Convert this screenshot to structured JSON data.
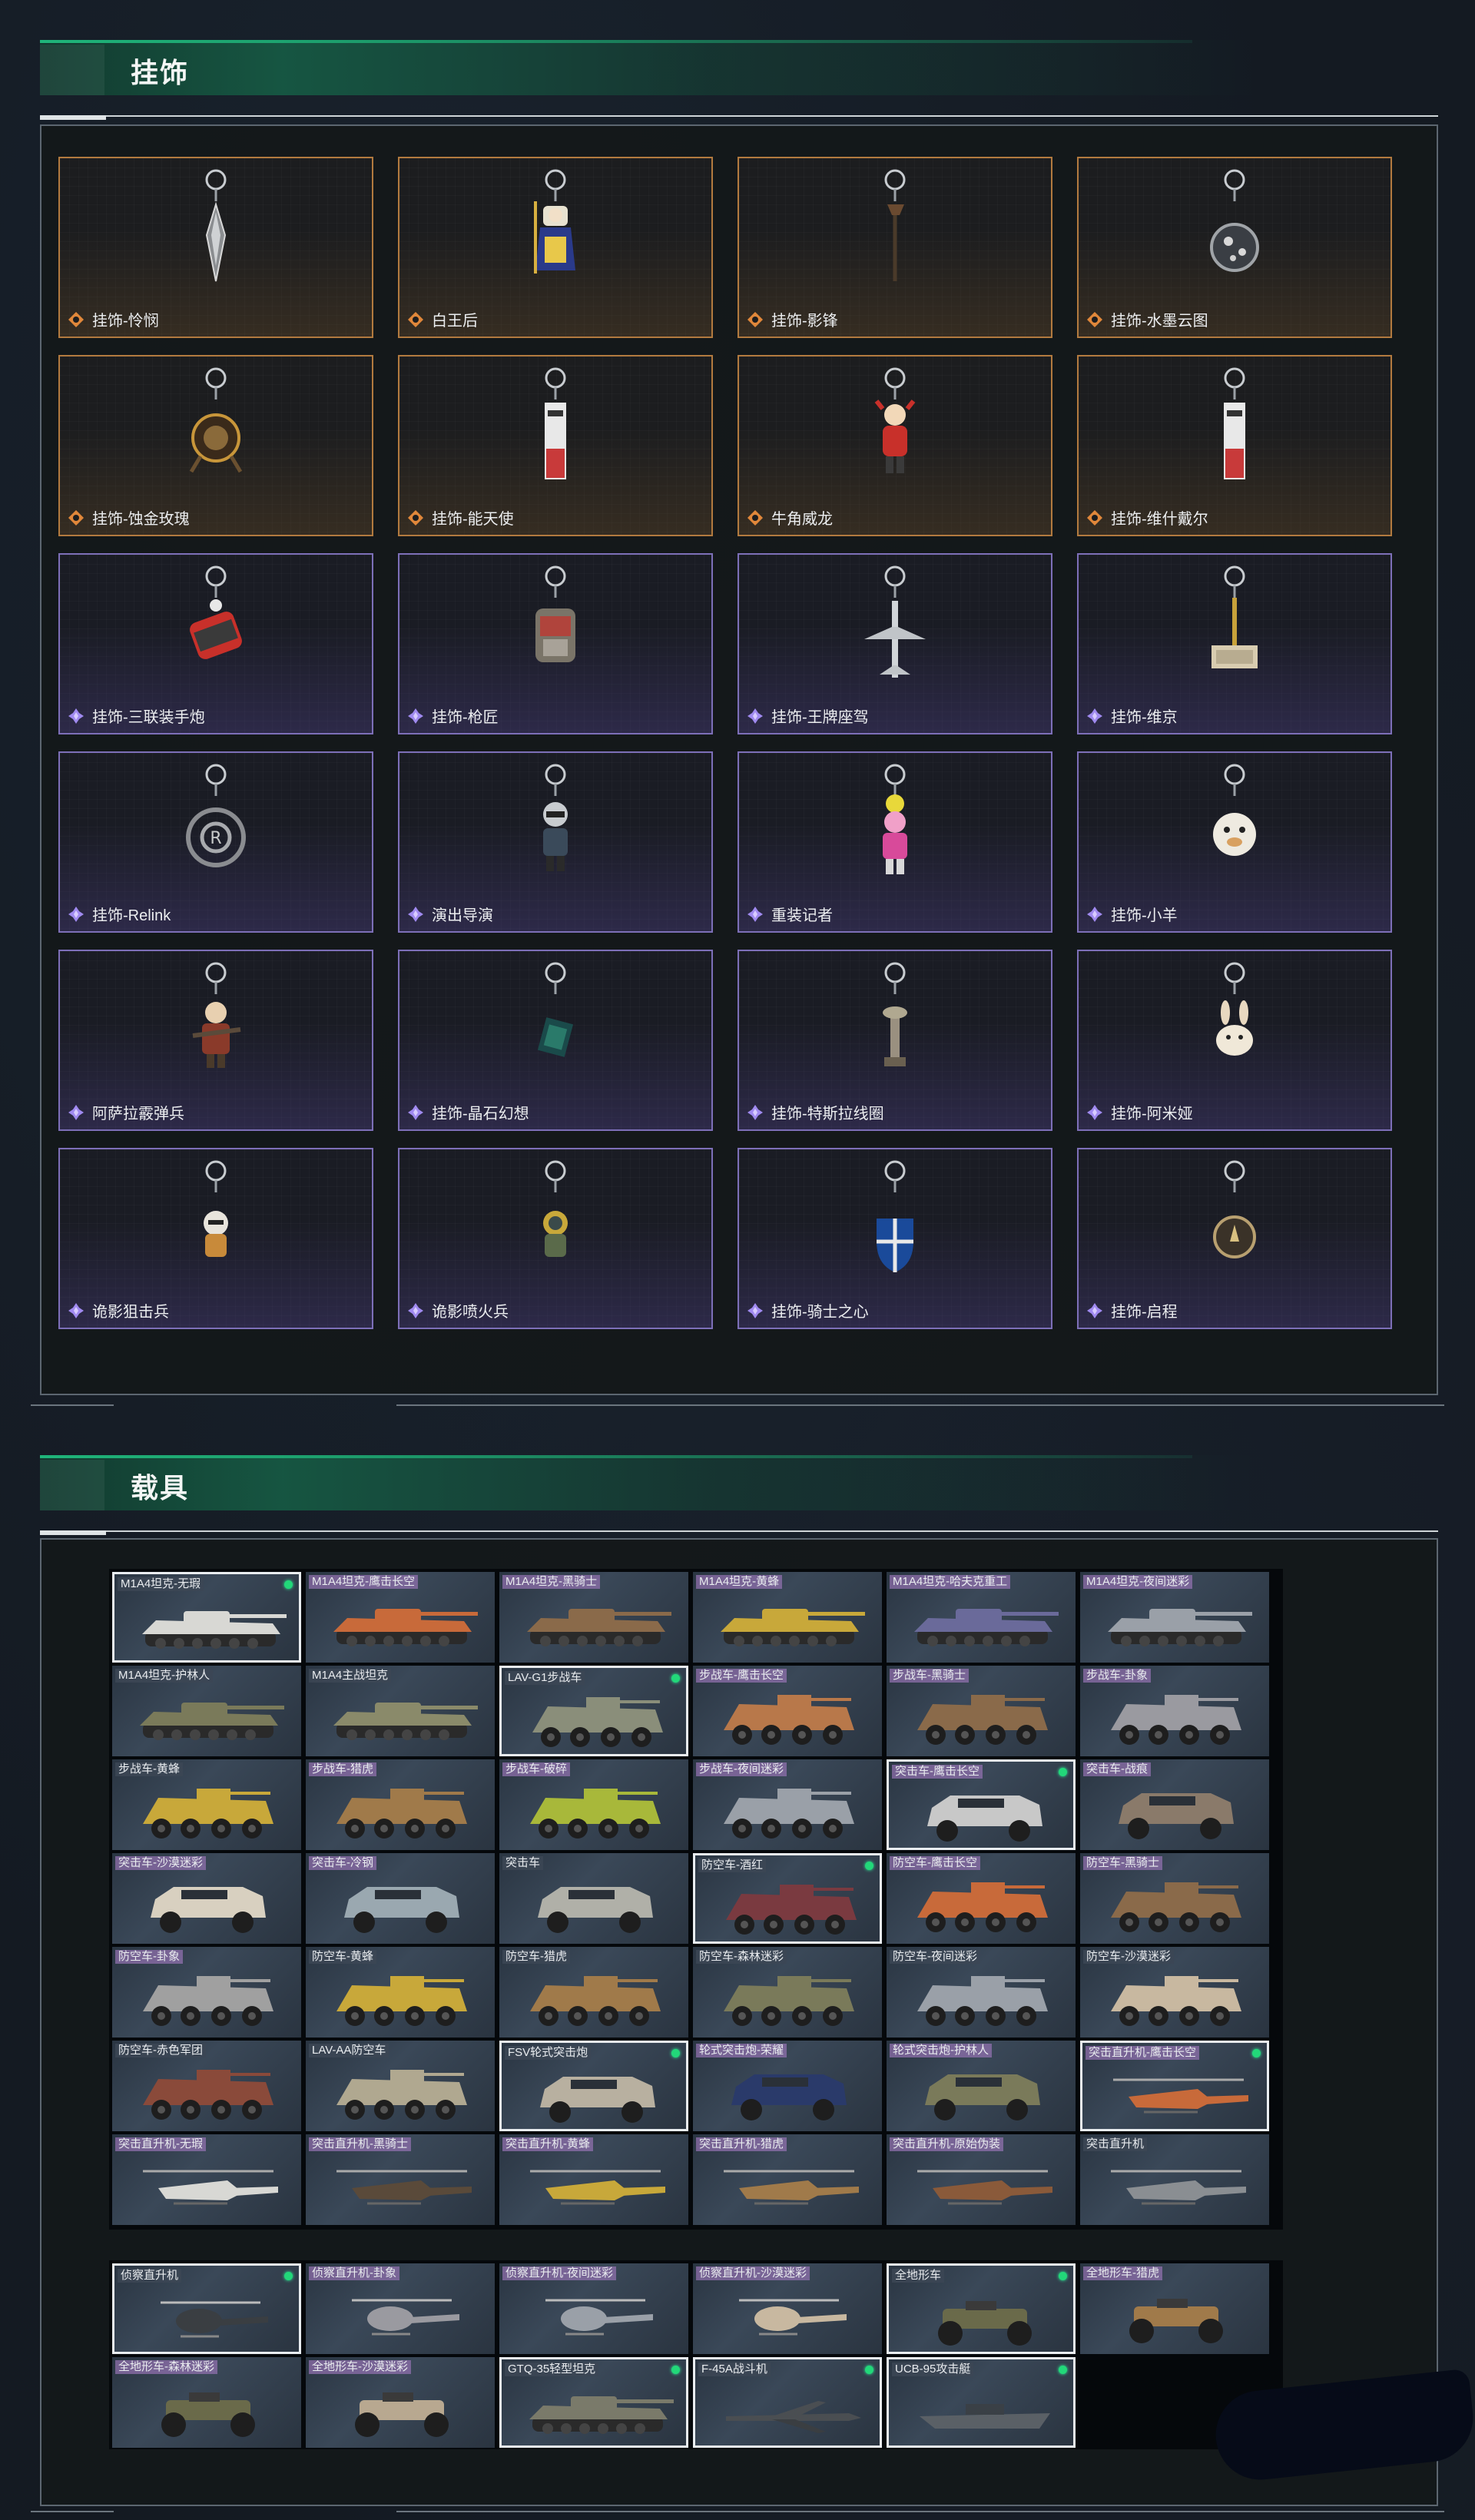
{
  "sections": {
    "charms_title": "挂饰",
    "vehicles_title": "载具"
  },
  "charms": [
    {
      "label": "挂饰-怜悯",
      "rarity": "gold",
      "icon": "charm-spike-icon"
    },
    {
      "label": "白王后",
      "rarity": "gold",
      "icon": "charm-queen-icon"
    },
    {
      "label": "挂饰-影锋",
      "rarity": "gold",
      "icon": "charm-blade-icon"
    },
    {
      "label": "挂饰-水墨云图",
      "rarity": "gold",
      "icon": "charm-orb-icon"
    },
    {
      "label": "挂饰-蚀金玫瑰",
      "rarity": "gold",
      "icon": "charm-rose-icon"
    },
    {
      "label": "挂饰-能天使",
      "rarity": "gold",
      "icon": "charm-tag-icon"
    },
    {
      "label": "牛角威龙",
      "rarity": "gold",
      "icon": "charm-figure-icon"
    },
    {
      "label": "挂饰-维什戴尔",
      "rarity": "gold",
      "icon": "charm-tag-icon"
    },
    {
      "label": "挂饰-三联装手炮",
      "rarity": "purple",
      "icon": "charm-cannon-icon"
    },
    {
      "label": "挂饰-枪匠",
      "rarity": "purple",
      "icon": "charm-pouch-icon"
    },
    {
      "label": "挂饰-王牌座驾",
      "rarity": "purple",
      "icon": "charm-jet-icon"
    },
    {
      "label": "挂饰-维京",
      "rarity": "purple",
      "icon": "charm-hammer-icon"
    },
    {
      "label": "挂饰-Relink",
      "rarity": "purple",
      "icon": "charm-knot-icon"
    },
    {
      "label": "演出导演",
      "rarity": "purple",
      "icon": "charm-soldier-icon"
    },
    {
      "label": "重装记者",
      "rarity": "purple",
      "icon": "charm-reporter-icon"
    },
    {
      "label": "挂饰-小羊",
      "rarity": "purple",
      "icon": "charm-lamb-icon"
    },
    {
      "label": "阿萨拉霰弹兵",
      "rarity": "purple",
      "icon": "charm-gunner-icon"
    },
    {
      "label": "挂饰-晶石幻想",
      "rarity": "purple",
      "icon": "charm-crystal-icon"
    },
    {
      "label": "挂饰-特斯拉线圈",
      "rarity": "purple",
      "icon": "charm-coil-icon"
    },
    {
      "label": "挂饰-阿米娅",
      "rarity": "purple",
      "icon": "charm-bunny-icon"
    },
    {
      "label": "诡影狙击兵",
      "rarity": "purple",
      "icon": "charm-sniper-icon"
    },
    {
      "label": "诡影喷火兵",
      "rarity": "purple",
      "icon": "charm-flamer-icon"
    },
    {
      "label": "挂饰-骑士之心",
      "rarity": "purple",
      "icon": "charm-shield-icon"
    },
    {
      "label": "挂饰-启程",
      "rarity": "purple",
      "icon": "charm-medal-icon"
    }
  ],
  "vehicles_main": [
    {
      "label": "M1A4坦克-无瑕",
      "selected": true,
      "dot": true,
      "kind": "tank",
      "color": "#d8d8d4"
    },
    {
      "label": "M1A4坦克-鹰击长空",
      "selected": false,
      "dot": false,
      "kind": "tank",
      "color": "#c86a3a",
      "hl": true
    },
    {
      "label": "M1A4坦克-黑骑士",
      "selected": false,
      "dot": false,
      "kind": "tank",
      "color": "#8a6a4a",
      "hl": true
    },
    {
      "label": "M1A4坦克-黄蜂",
      "selected": false,
      "dot": false,
      "kind": "tank",
      "color": "#c8a83a",
      "hl": true
    },
    {
      "label": "M1A4坦克-哈夫克重工",
      "selected": false,
      "dot": false,
      "kind": "tank",
      "color": "#6a6a9a",
      "hl": true
    },
    {
      "label": "M1A4坦克-夜间迷彩",
      "selected": false,
      "dot": false,
      "kind": "tank",
      "color": "#9aa0a8",
      "hl": true
    },
    {
      "label": "M1A4坦克-护林人",
      "selected": false,
      "dot": false,
      "kind": "tank",
      "color": "#7a7a5a",
      "hl": false
    },
    {
      "label": "M1A4主战坦克",
      "selected": false,
      "dot": false,
      "kind": "tank",
      "color": "#8a8a6a",
      "hl": false
    },
    {
      "label": "LAV-G1步战车",
      "selected": true,
      "dot": true,
      "kind": "ifv",
      "color": "#8a8e7a",
      "hl": false
    },
    {
      "label": "步战车-鹰击长空",
      "selected": false,
      "dot": false,
      "kind": "ifv",
      "color": "#b8784a",
      "hl": true
    },
    {
      "label": "步战车-黑骑士",
      "selected": false,
      "dot": false,
      "kind": "ifv",
      "color": "#8a6a4a",
      "hl": true
    },
    {
      "label": "步战车-卦象",
      "selected": false,
      "dot": false,
      "kind": "ifv",
      "color": "#9a9aa0",
      "hl": true
    },
    {
      "label": "步战车-黄蜂",
      "selected": false,
      "dot": false,
      "kind": "ifv",
      "color": "#c8a83a",
      "hl": false
    },
    {
      "label": "步战车-猎虎",
      "selected": false,
      "dot": false,
      "kind": "ifv",
      "color": "#a07a4a",
      "hl": true
    },
    {
      "label": "步战车-破碎",
      "selected": false,
      "dot": false,
      "kind": "ifv",
      "color": "#a8b83a",
      "hl": true
    },
    {
      "label": "步战车-夜间迷彩",
      "selected": false,
      "dot": false,
      "kind": "ifv",
      "color": "#9aa0a8",
      "hl": true
    },
    {
      "label": "突击车-鹰击长空",
      "selected": true,
      "dot": true,
      "kind": "car",
      "color": "#c8c8c8",
      "hl": true
    },
    {
      "label": "突击车-战痕",
      "selected": false,
      "dot": false,
      "kind": "car",
      "color": "#8a7a6a",
      "hl": true
    },
    {
      "label": "突击车-沙漠迷彩",
      "selected": false,
      "dot": false,
      "kind": "car",
      "color": "#d8d0c0",
      "hl": true
    },
    {
      "label": "突击车-冷钢",
      "selected": false,
      "dot": false,
      "kind": "car",
      "color": "#9aa8b0",
      "hl": true
    },
    {
      "label": "突击车",
      "selected": false,
      "dot": false,
      "kind": "car",
      "color": "#b0b0a8",
      "hl": false
    },
    {
      "label": "防空车-酒红",
      "selected": true,
      "dot": true,
      "kind": "aa",
      "color": "#7a3a40",
      "hl": false
    },
    {
      "label": "防空车-鹰击长空",
      "selected": false,
      "dot": false,
      "kind": "aa",
      "color": "#c86a3a",
      "hl": true
    },
    {
      "label": "防空车-黑骑士",
      "selected": false,
      "dot": false,
      "kind": "aa",
      "color": "#8a6a4a",
      "hl": true
    },
    {
      "label": "防空车-卦象",
      "selected": false,
      "dot": false,
      "kind": "aa",
      "color": "#a0a0a0",
      "hl": true
    },
    {
      "label": "防空车-黄蜂",
      "selected": false,
      "dot": false,
      "kind": "aa",
      "color": "#c8a83a",
      "hl": false
    },
    {
      "label": "防空车-猎虎",
      "selected": false,
      "dot": false,
      "kind": "aa",
      "color": "#a07a4a",
      "hl": false
    },
    {
      "label": "防空车-森林迷彩",
      "selected": false,
      "dot": false,
      "kind": "aa",
      "color": "#7a7a5a",
      "hl": false
    },
    {
      "label": "防空车-夜间迷彩",
      "selected": false,
      "dot": false,
      "kind": "aa",
      "color": "#9aa0a8",
      "hl": false
    },
    {
      "label": "防空车-沙漠迷彩",
      "selected": false,
      "dot": false,
      "kind": "aa",
      "color": "#c8b8a0",
      "hl": false
    },
    {
      "label": "防空车-赤色军团",
      "selected": false,
      "dot": false,
      "kind": "aa",
      "color": "#8a4a3a",
      "hl": false
    },
    {
      "label": "LAV-AA防空车",
      "selected": false,
      "dot": false,
      "kind": "aa",
      "color": "#b0a890",
      "hl": false
    },
    {
      "label": "FSV轮式突击炮",
      "selected": true,
      "dot": true,
      "kind": "car",
      "color": "#b8b0a0",
      "hl": false
    },
    {
      "label": "轮式突击炮-荣耀",
      "selected": false,
      "dot": false,
      "kind": "car",
      "color": "#2a3a6a",
      "hl": true
    },
    {
      "label": "轮式突击炮-护林人",
      "selected": false,
      "dot": false,
      "kind": "car",
      "color": "#7a7a5a",
      "hl": true
    },
    {
      "label": "突击直升机-鹰击长空",
      "selected": true,
      "dot": true,
      "kind": "heli",
      "color": "#c86a3a",
      "hl": true
    },
    {
      "label": "突击直升机-无瑕",
      "selected": false,
      "dot": false,
      "kind": "heli",
      "color": "#d8d8d4",
      "hl": true
    },
    {
      "label": "突击直升机-黑骑士",
      "selected": false,
      "dot": false,
      "kind": "heli",
      "color": "#5a4a3a",
      "hl": true
    },
    {
      "label": "突击直升机-黄蜂",
      "selected": false,
      "dot": false,
      "kind": "heli",
      "color": "#c8a83a",
      "hl": true
    },
    {
      "label": "突击直升机-猎虎",
      "selected": false,
      "dot": false,
      "kind": "heli",
      "color": "#a07a4a",
      "hl": true
    },
    {
      "label": "突击直升机-原始伪装",
      "selected": false,
      "dot": false,
      "kind": "heli",
      "color": "#8a5a3a",
      "hl": true
    },
    {
      "label": "突击直升机",
      "selected": false,
      "dot": false,
      "kind": "heli",
      "color": "#8a8e92",
      "hl": false
    }
  ],
  "vehicles_extra": [
    {
      "label": "侦察直升机",
      "selected": true,
      "dot": true,
      "kind": "scout",
      "color": "#3a3e42",
      "hl": false
    },
    {
      "label": "侦察直升机-卦象",
      "selected": false,
      "dot": false,
      "kind": "scout",
      "color": "#9a9aa0",
      "hl": true
    },
    {
      "label": "侦察直升机-夜间迷彩",
      "selected": false,
      "dot": false,
      "kind": "scout",
      "color": "#9aa0a8",
      "hl": true
    },
    {
      "label": "侦察直升机-沙漠迷彩",
      "selected": false,
      "dot": false,
      "kind": "scout",
      "color": "#c8b8a0",
      "hl": true
    },
    {
      "label": "全地形车",
      "selected": true,
      "dot": true,
      "kind": "atv",
      "color": "#6a6a4a",
      "hl": false
    },
    {
      "label": "全地形车-猎虎",
      "selected": false,
      "dot": false,
      "kind": "atv",
      "color": "#a07a4a",
      "hl": true
    },
    {
      "label": "全地形车-森林迷彩",
      "selected": false,
      "dot": false,
      "kind": "atv",
      "color": "#6a6a4a",
      "hl": true
    },
    {
      "label": "全地形车-沙漠迷彩",
      "selected": false,
      "dot": false,
      "kind": "atv",
      "color": "#b8a890",
      "hl": true
    },
    {
      "label": "GTQ-35轻型坦克",
      "selected": true,
      "dot": true,
      "kind": "tank",
      "color": "#7a7a6a",
      "hl": false
    },
    {
      "label": "F-45A战斗机",
      "selected": true,
      "dot": true,
      "kind": "jet",
      "color": "#4a4e52",
      "hl": false
    },
    {
      "label": "UCB-95攻击艇",
      "selected": true,
      "dot": true,
      "kind": "boat",
      "color": "#5a6066",
      "hl": false
    }
  ],
  "colors": {
    "gold_frame": "#b27a3f",
    "purple_frame": "#7d6fb8",
    "owned_dot": "#22d879",
    "header_accent": "#1fb57a"
  }
}
